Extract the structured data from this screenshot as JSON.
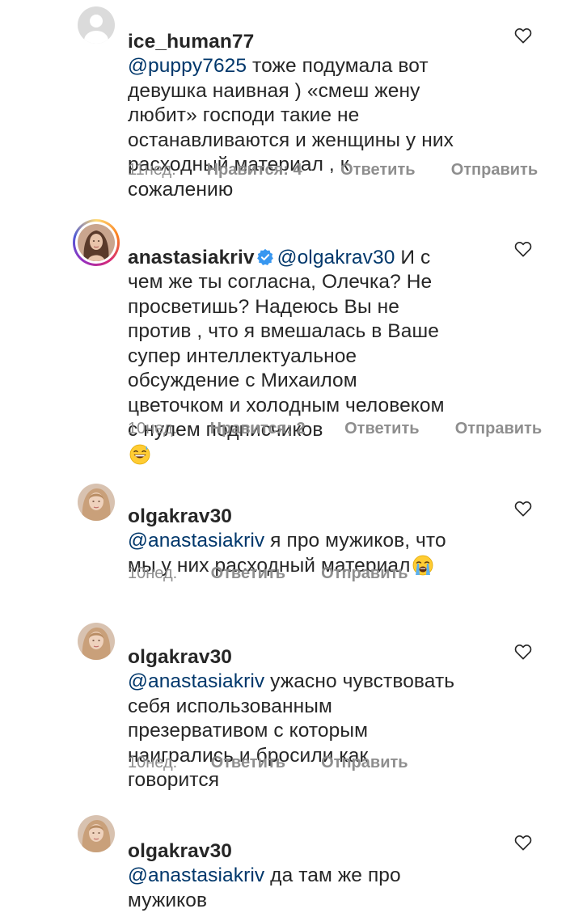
{
  "comments": [
    {
      "username": "ice_human77",
      "mention": "@puppy7625",
      "text": " тоже подумала вот девушка наивная ) «смеш жену любит» господи такие не останавливаются и женщины у них расходный материал , к сожалению",
      "time": "11нед.",
      "likes": "Нравится: 4",
      "reply": "Ответить",
      "send": "Отправить",
      "avatar": "default-avatar",
      "verified": false
    },
    {
      "username": "anastasiakriv",
      "mention": "@olgakrav30",
      "text": " И с чем же ты согласна, Олечка? Не просветишь?  Надеюсь Вы не против , что я вмешалась в Ваше супер интеллектуальное обсуждение с Михаилом цветочком и холодным человеком с нулем подписчиков",
      "emoji": "grinning-sweat-emoji",
      "time": "10нед.",
      "likes": "Нравится: 2",
      "reply": "Ответить",
      "send": "Отправить",
      "avatar": "story-ring-avatar",
      "verified": true
    },
    {
      "username": "olgakrav30",
      "mention": "@anastasiakriv",
      "text": " я про мужиков, что мы у них расходный материал",
      "emoji": "crying-emoji",
      "time": "10нед.",
      "reply": "Ответить",
      "send": "Отправить",
      "avatar": "photo-avatar",
      "verified": false
    },
    {
      "username": "olgakrav30",
      "mention": "@anastasiakriv",
      "text": " ужасно чувствовать себя использованным презервативом с которым наигрались и бросили как говорится",
      "time": "10нед.",
      "reply": "Ответить",
      "send": "Отправить",
      "avatar": "photo-avatar",
      "verified": false
    },
    {
      "username": "olgakrav30",
      "mention": "@anastasiakriv",
      "text": " да там же про мужиков",
      "avatar": "photo-avatar",
      "verified": false
    }
  ],
  "colors": {
    "text": "#262626",
    "mention": "#00376b",
    "meta": "#8e8e8e",
    "verified": "#3897f0"
  }
}
